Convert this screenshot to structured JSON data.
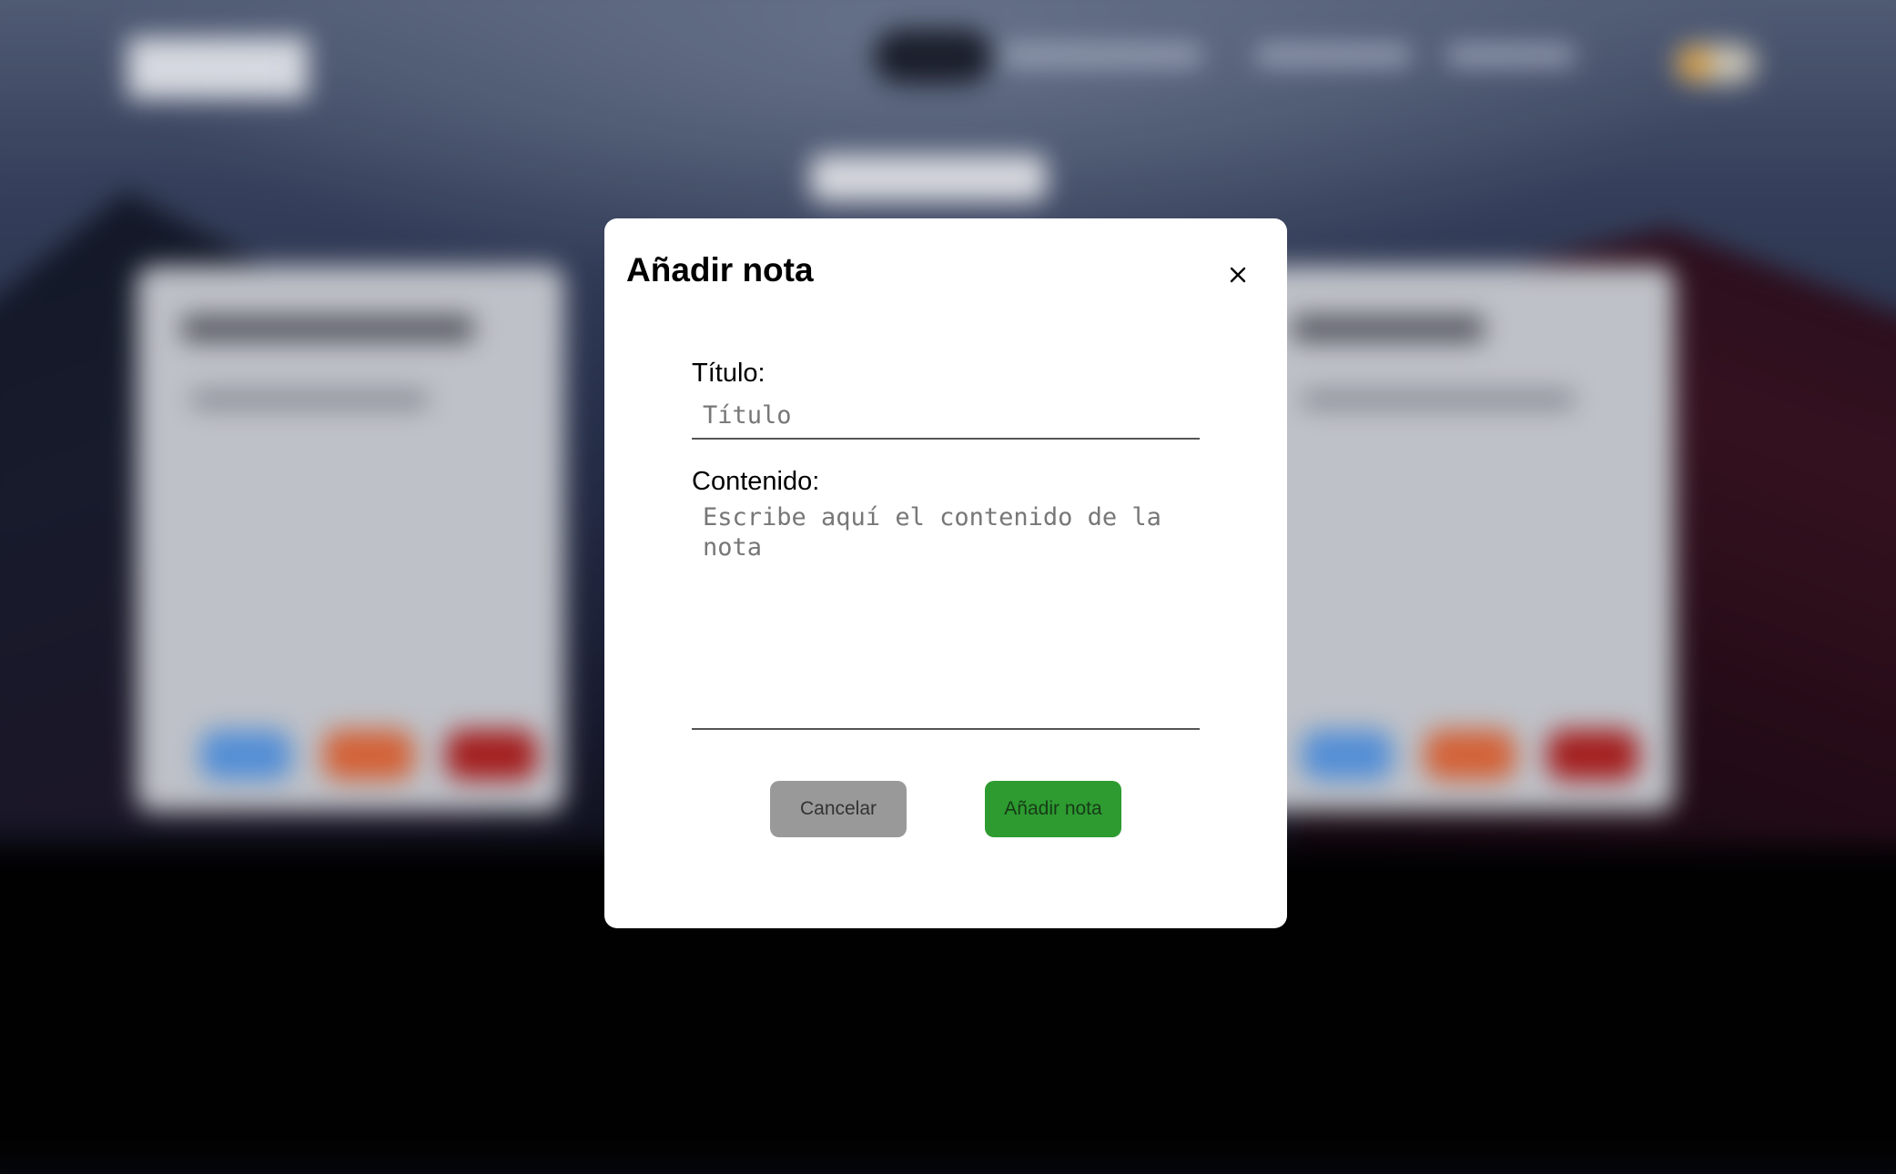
{
  "dialog": {
    "title": "Añadir nota",
    "close_icon": "close-icon",
    "fields": {
      "title_label": "Título:",
      "title_placeholder": "Título",
      "title_value": "",
      "content_label": "Contenido:",
      "content_placeholder": "Escribe aquí el contenido de la nota",
      "content_value": ""
    },
    "buttons": {
      "cancel_label": "Cancelar",
      "add_label": "Añadir nota"
    }
  },
  "colors": {
    "add_button": "#2e9b31",
    "cancel_button": "#999999",
    "modal_background": "#ffffff"
  }
}
